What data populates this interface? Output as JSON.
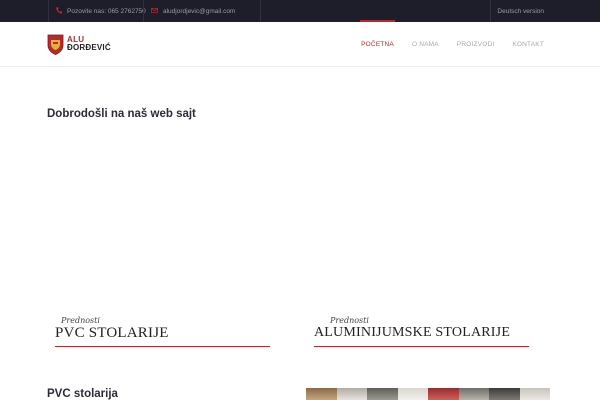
{
  "topbar": {
    "phone_text": "Pozovite nas: 065 2762750",
    "email_text": "aludjordjevic@gmail.com",
    "language_link": "Deutsch version",
    "icons": {
      "phone": "phone-icon",
      "email": "envelope-icon"
    }
  },
  "header": {
    "logo": {
      "line1": "ALU",
      "line2": "ĐORĐEVIĆ"
    },
    "nav": [
      {
        "label": "POČETNA",
        "active": true
      },
      {
        "label": "O NAMA"
      },
      {
        "label": "PROIZVODI"
      },
      {
        "label": "KONTAKT"
      }
    ]
  },
  "main": {
    "welcome_heading": "Dobrodošli na naš web sajt",
    "banners": [
      {
        "script": "Prednosti",
        "title": "PVC STOLARIJE"
      },
      {
        "script": "Prednosti",
        "title": "ALUMINIJUMSKE STOLARIJE"
      }
    ],
    "section_title": "PVC stolarija"
  },
  "colors": {
    "accent": "#b8292d",
    "topbar_bg": "#1e1e2b",
    "heading": "#2b2b3a",
    "nav_inactive": "#a9a9a9"
  }
}
